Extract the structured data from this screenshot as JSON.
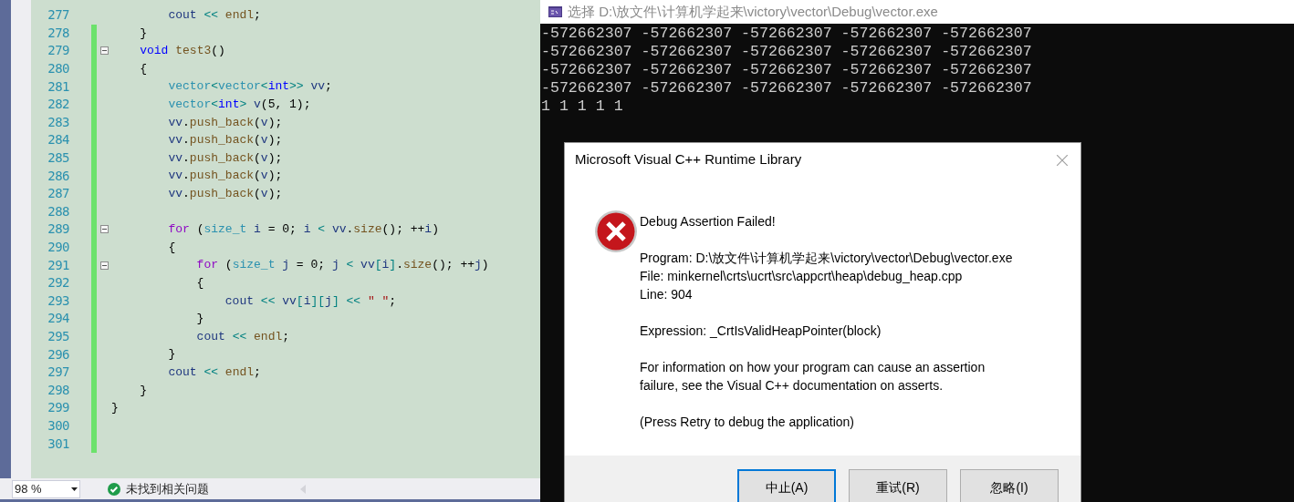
{
  "editor": {
    "lines": [
      {
        "number": "277",
        "changed": false,
        "fold_marker": false,
        "segments": [
          {
            "text": "        cout",
            "kind": "var"
          },
          {
            "text": " << ",
            "kind": "op"
          },
          {
            "text": "endl",
            "kind": "func"
          },
          {
            "text": ";",
            "kind": "plain"
          }
        ]
      },
      {
        "number": "278",
        "changed": true,
        "fold_marker": false,
        "segments": [
          {
            "text": "    }",
            "kind": "plain"
          }
        ]
      },
      {
        "number": "279",
        "changed": true,
        "fold_marker": true,
        "segments": [
          {
            "text": "    void",
            "kind": "keyword"
          },
          {
            "text": " test3",
            "kind": "func"
          },
          {
            "text": "()",
            "kind": "plain"
          }
        ]
      },
      {
        "number": "280",
        "changed": true,
        "fold_marker": false,
        "segments": [
          {
            "text": "    {",
            "kind": "plain"
          }
        ]
      },
      {
        "number": "281",
        "changed": true,
        "fold_marker": false,
        "segments": [
          {
            "text": "        vector",
            "kind": "type"
          },
          {
            "text": "<",
            "kind": "op"
          },
          {
            "text": "vector",
            "kind": "type"
          },
          {
            "text": "<",
            "kind": "op"
          },
          {
            "text": "int",
            "kind": "keyword"
          },
          {
            "text": ">>",
            "kind": "op"
          },
          {
            "text": " vv",
            "kind": "var"
          },
          {
            "text": ";",
            "kind": "plain"
          }
        ]
      },
      {
        "number": "282",
        "changed": true,
        "fold_marker": false,
        "segments": [
          {
            "text": "        vector",
            "kind": "type"
          },
          {
            "text": "<",
            "kind": "op"
          },
          {
            "text": "int",
            "kind": "keyword"
          },
          {
            "text": ">",
            "kind": "op"
          },
          {
            "text": " v",
            "kind": "var"
          },
          {
            "text": "(5, 1);",
            "kind": "plain"
          }
        ]
      },
      {
        "number": "283",
        "changed": true,
        "fold_marker": false,
        "segments": [
          {
            "text": "        vv",
            "kind": "var"
          },
          {
            "text": ".",
            "kind": "plain"
          },
          {
            "text": "push_back",
            "kind": "func"
          },
          {
            "text": "(",
            "kind": "plain"
          },
          {
            "text": "v",
            "kind": "var"
          },
          {
            "text": ");",
            "kind": "plain"
          }
        ]
      },
      {
        "number": "284",
        "changed": true,
        "fold_marker": false,
        "segments": [
          {
            "text": "        vv",
            "kind": "var"
          },
          {
            "text": ".",
            "kind": "plain"
          },
          {
            "text": "push_back",
            "kind": "func"
          },
          {
            "text": "(",
            "kind": "plain"
          },
          {
            "text": "v",
            "kind": "var"
          },
          {
            "text": ");",
            "kind": "plain"
          }
        ]
      },
      {
        "number": "285",
        "changed": true,
        "fold_marker": false,
        "segments": [
          {
            "text": "        vv",
            "kind": "var"
          },
          {
            "text": ".",
            "kind": "plain"
          },
          {
            "text": "push_back",
            "kind": "func"
          },
          {
            "text": "(",
            "kind": "plain"
          },
          {
            "text": "v",
            "kind": "var"
          },
          {
            "text": ");",
            "kind": "plain"
          }
        ]
      },
      {
        "number": "286",
        "changed": true,
        "fold_marker": false,
        "segments": [
          {
            "text": "        vv",
            "kind": "var"
          },
          {
            "text": ".",
            "kind": "plain"
          },
          {
            "text": "push_back",
            "kind": "func"
          },
          {
            "text": "(",
            "kind": "plain"
          },
          {
            "text": "v",
            "kind": "var"
          },
          {
            "text": ");",
            "kind": "plain"
          }
        ]
      },
      {
        "number": "287",
        "changed": true,
        "fold_marker": false,
        "segments": [
          {
            "text": "        vv",
            "kind": "var"
          },
          {
            "text": ".",
            "kind": "plain"
          },
          {
            "text": "push_back",
            "kind": "func"
          },
          {
            "text": "(",
            "kind": "plain"
          },
          {
            "text": "v",
            "kind": "var"
          },
          {
            "text": ");",
            "kind": "plain"
          }
        ]
      },
      {
        "number": "288",
        "changed": true,
        "fold_marker": false
      },
      {
        "number": "289",
        "changed": true,
        "fold_marker": true,
        "segments": [
          {
            "text": "        for",
            "kind": "control"
          },
          {
            "text": " (",
            "kind": "plain"
          },
          {
            "text": "size_t",
            "kind": "type"
          },
          {
            "text": " i",
            "kind": "var"
          },
          {
            "text": " = 0; ",
            "kind": "plain"
          },
          {
            "text": "i",
            "kind": "var"
          },
          {
            "text": " < ",
            "kind": "op"
          },
          {
            "text": "vv",
            "kind": "var"
          },
          {
            "text": ".",
            "kind": "plain"
          },
          {
            "text": "size",
            "kind": "func"
          },
          {
            "text": "(); ++",
            "kind": "plain"
          },
          {
            "text": "i",
            "kind": "var"
          },
          {
            "text": ")",
            "kind": "plain"
          }
        ]
      },
      {
        "number": "290",
        "changed": true,
        "fold_marker": false,
        "segments": [
          {
            "text": "        {",
            "kind": "plain"
          }
        ]
      },
      {
        "number": "291",
        "changed": true,
        "fold_marker": true,
        "segments": [
          {
            "text": "            for",
            "kind": "control"
          },
          {
            "text": " (",
            "kind": "plain"
          },
          {
            "text": "size_t",
            "kind": "type"
          },
          {
            "text": " j",
            "kind": "var"
          },
          {
            "text": " = 0; ",
            "kind": "plain"
          },
          {
            "text": "j",
            "kind": "var"
          },
          {
            "text": " < ",
            "kind": "op"
          },
          {
            "text": "vv",
            "kind": "var"
          },
          {
            "text": "[",
            "kind": "op"
          },
          {
            "text": "i",
            "kind": "var"
          },
          {
            "text": "]",
            "kind": "op"
          },
          {
            "text": ".",
            "kind": "plain"
          },
          {
            "text": "size",
            "kind": "func"
          },
          {
            "text": "(); ++",
            "kind": "plain"
          },
          {
            "text": "j",
            "kind": "var"
          },
          {
            "text": ")",
            "kind": "plain"
          }
        ]
      },
      {
        "number": "292",
        "changed": true,
        "fold_marker": false,
        "segments": [
          {
            "text": "            {",
            "kind": "plain"
          }
        ]
      },
      {
        "number": "293",
        "changed": true,
        "fold_marker": false,
        "segments": [
          {
            "text": "                cout",
            "kind": "var"
          },
          {
            "text": " << ",
            "kind": "op"
          },
          {
            "text": "vv",
            "kind": "var"
          },
          {
            "text": "[",
            "kind": "op"
          },
          {
            "text": "i",
            "kind": "var"
          },
          {
            "text": "][",
            "kind": "op"
          },
          {
            "text": "j",
            "kind": "var"
          },
          {
            "text": "]",
            "kind": "op"
          },
          {
            "text": " << ",
            "kind": "op"
          },
          {
            "text": "\" \"",
            "kind": "str"
          },
          {
            "text": ";",
            "kind": "plain"
          }
        ]
      },
      {
        "number": "294",
        "changed": true,
        "fold_marker": false,
        "segments": [
          {
            "text": "            }",
            "kind": "plain"
          }
        ]
      },
      {
        "number": "295",
        "changed": true,
        "fold_marker": false,
        "segments": [
          {
            "text": "            cout",
            "kind": "var"
          },
          {
            "text": " << ",
            "kind": "op"
          },
          {
            "text": "endl",
            "kind": "func"
          },
          {
            "text": ";",
            "kind": "plain"
          }
        ]
      },
      {
        "number": "296",
        "changed": true,
        "fold_marker": false,
        "segments": [
          {
            "text": "        }",
            "kind": "plain"
          }
        ]
      },
      {
        "number": "297",
        "changed": true,
        "fold_marker": false,
        "segments": [
          {
            "text": "        cout",
            "kind": "var"
          },
          {
            "text": " << ",
            "kind": "op"
          },
          {
            "text": "endl",
            "kind": "func"
          },
          {
            "text": ";",
            "kind": "plain"
          }
        ]
      },
      {
        "number": "298",
        "changed": true,
        "fold_marker": false,
        "segments": [
          {
            "text": "    }",
            "kind": "plain"
          }
        ]
      },
      {
        "number": "299",
        "changed": true,
        "fold_marker": false,
        "segments": [
          {
            "text": "}",
            "kind": "plain"
          }
        ]
      },
      {
        "number": "300",
        "changed": true,
        "fold_marker": false
      },
      {
        "number": "301",
        "changed": true,
        "fold_marker": false
      }
    ]
  },
  "status_bar": {
    "zoom": "98 %",
    "issues": "未找到相关问题"
  },
  "console": {
    "title": "选择 D:\\放文件\\计算机学起来\\victory\\vector\\Debug\\vector.exe",
    "output_lines": [
      "-572662307 -572662307 -572662307 -572662307 -572662307",
      "-572662307 -572662307 -572662307 -572662307 -572662307",
      "-572662307 -572662307 -572662307 -572662307 -572662307",
      "-572662307 -572662307 -572662307 -572662307 -572662307",
      "1 1 1 1 1"
    ]
  },
  "dialog": {
    "title": "Microsoft Visual C++ Runtime Library",
    "paragraphs": [
      [
        "Debug Assertion Failed!"
      ],
      [
        "Program: D:\\放文件\\计算机学起来\\victory\\vector\\Debug\\vector.exe",
        "File: minkernel\\crts\\ucrt\\src\\appcrt\\heap\\debug_heap.cpp",
        "Line: 904"
      ],
      [
        "Expression: _CrtIsValidHeapPointer(block)"
      ],
      [
        "For information on how your program can cause an assertion failure, see the Visual C++ documentation on asserts."
      ],
      [
        "(Press Retry to debug the application)"
      ]
    ],
    "buttons": [
      {
        "label": "中止(A)",
        "default": true
      },
      {
        "label": "重试(R)",
        "default": false
      },
      {
        "label": "忽略(I)",
        "default": false
      }
    ]
  }
}
